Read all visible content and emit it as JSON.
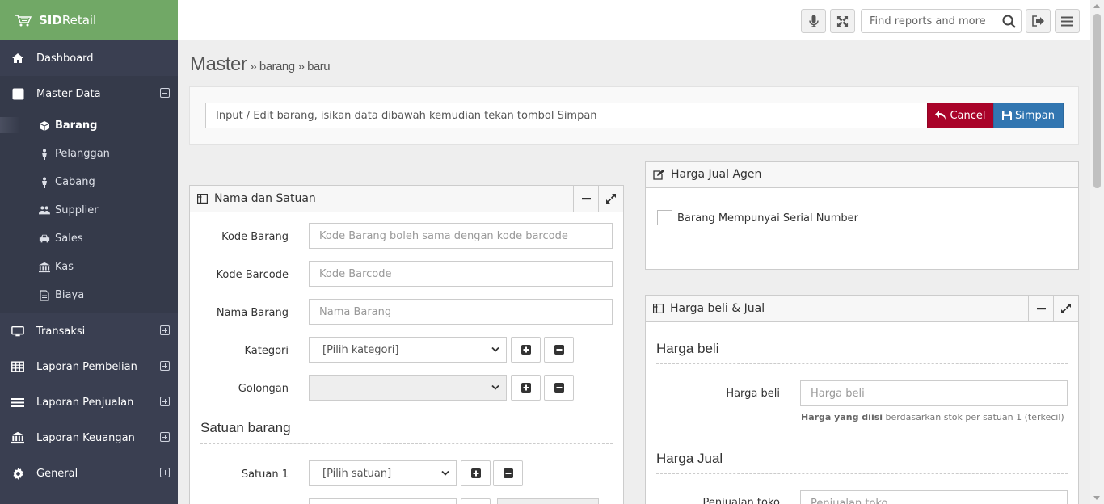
{
  "brand": {
    "bold": "SID",
    "light": "Retail"
  },
  "nav": {
    "dashboard": "Dashboard",
    "master": "Master Data",
    "sub": [
      "Barang",
      "Pelanggan",
      "Cabang",
      "Supplier",
      "Sales",
      "Kas",
      "Biaya"
    ],
    "transaksi": "Transaksi",
    "lap_pembelian": "Laporan Pembelian",
    "lap_penjualan": "Laporan Penjualan",
    "lap_keuangan": "Laporan Keuangan",
    "general": "General"
  },
  "topbar": {
    "search_placeholder": "Find reports and more"
  },
  "page": {
    "title": "Master",
    "crumb1": "» barang",
    "crumb2": "» baru",
    "info": "Input / Edit barang, isikan data dibawah kemudian tekan tombol Simpan",
    "cancel": "Cancel",
    "simpan": "Simpan"
  },
  "w_nama": {
    "title": "Nama dan Satuan",
    "kode_barang_label": "Kode Barang",
    "kode_barang_ph": "Kode Barang boleh sama dengan kode barcode",
    "kode_barcode_label": "Kode Barcode",
    "kode_barcode_ph": "Kode Barcode",
    "nama_label": "Nama Barang",
    "nama_ph": "Nama Barang",
    "kategori_label": "Kategori",
    "kategori_value": "[Pilih kategori]",
    "golongan_label": "Golongan",
    "golongan_value": "",
    "satuan_title": "Satuan barang",
    "satuan1_label": "Satuan 1",
    "satuan1_value": "[Pilih satuan]"
  },
  "w_agen": {
    "title": "Harga Jual Agen",
    "serial_label": "Barang Mempunyai Serial Number"
  },
  "w_harga": {
    "title": "Harga beli & Jual",
    "beli_title": "Harga beli",
    "beli_label": "Harga beli",
    "beli_ph": "Harga beli",
    "help_bold": "Harga yang diisi",
    "help_rest": " berdasarkan stok per satuan 1 (terkecil)",
    "jual_title": "Harga Jual",
    "toko_label": "Penjualan toko",
    "toko_ph": "Penjualan toko"
  }
}
